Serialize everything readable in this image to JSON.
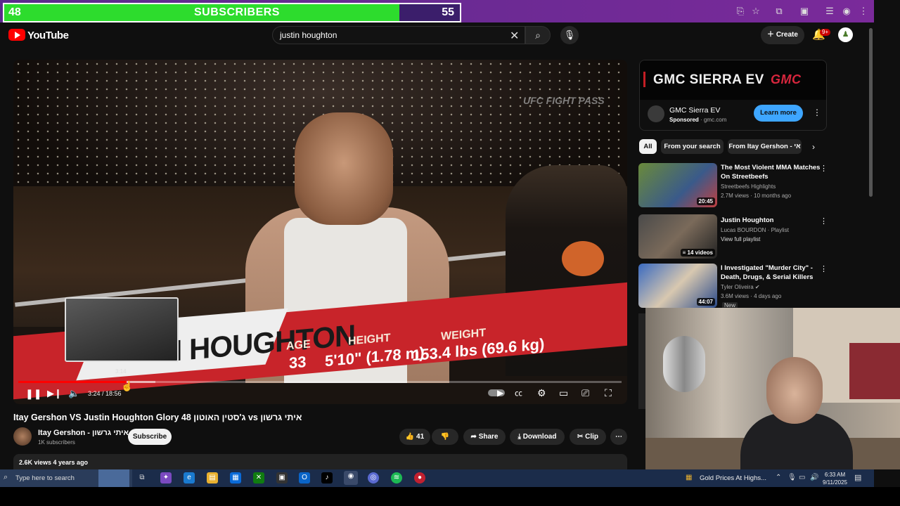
{
  "sub_goal": {
    "current": "48",
    "label": "SUBSCRIBERS",
    "goal": "55",
    "progress_fraction": 0.867
  },
  "header": {
    "logo_text": "YouTube",
    "search_value": "justin houghton",
    "create_label": "Create",
    "notif_badge": "9+"
  },
  "player": {
    "watermark": "UFC FIGHT PASS",
    "lower_third": {
      "name": "HOUGHTON",
      "name_partial": "N",
      "age_label": "AGE",
      "age": "33",
      "height_label": "HEIGHT",
      "height": "5'10\" (1.78 m)",
      "weight_label": "WEIGHT",
      "weight": "153.4 lbs (69.6 kg)"
    },
    "preview_time": "3:14",
    "time_display": "3:24 / 18:56",
    "progress_fraction": 0.18
  },
  "video": {
    "title": "Itay Gershon VS Justin Houghton Glory 48 ג'סטין האוטון vs איתי גרשון",
    "channel_name": "Itay Gershon - איתי גרשון",
    "channel_subs": "1K subscribers",
    "subscribe_label": "Subscribe",
    "likes": "41",
    "share_label": "Share",
    "download_label": "Download",
    "clip_label": "Clip",
    "views_meta": "2.6K views  4 years ago"
  },
  "ad": {
    "banner_text": "GMC SIERRA EV",
    "brand_logo": "GMC",
    "title": "GMC Sierra EV",
    "sponsored": "Sponsored",
    "domain": "· gmc.com",
    "cta": "Learn more"
  },
  "chips": [
    "All",
    "From your search",
    "From Itay Gershon - אי"
  ],
  "recommendations": [
    {
      "title": "The Most Violent MMA Matches On Streetbeefs",
      "channel": "Streetbeefs Highlights",
      "meta": "2.7M views · 10 months ago",
      "duration": "20:45"
    },
    {
      "title": "Justin Houghton",
      "channel": "Lucas BOURDON · Playlist",
      "meta": "View full playlist",
      "duration": "14 videos"
    },
    {
      "title": "I Investigated \"Murder City\" - Death, Drugs, & Serial Killers",
      "channel": "Tyler Oliveira",
      "meta": "3.6M views · 4 days ago",
      "duration": "44:07",
      "badge": "New"
    }
  ],
  "taskbar": {
    "search_placeholder": "Type here to search",
    "news": "Gold Prices At Highs...",
    "time": "6:33 AM",
    "date": "9/11/2025"
  },
  "colors": {
    "accent": "#ff0000",
    "subscribe_bar": "#2ddc2d",
    "learn_more": "#3ea6ff"
  }
}
